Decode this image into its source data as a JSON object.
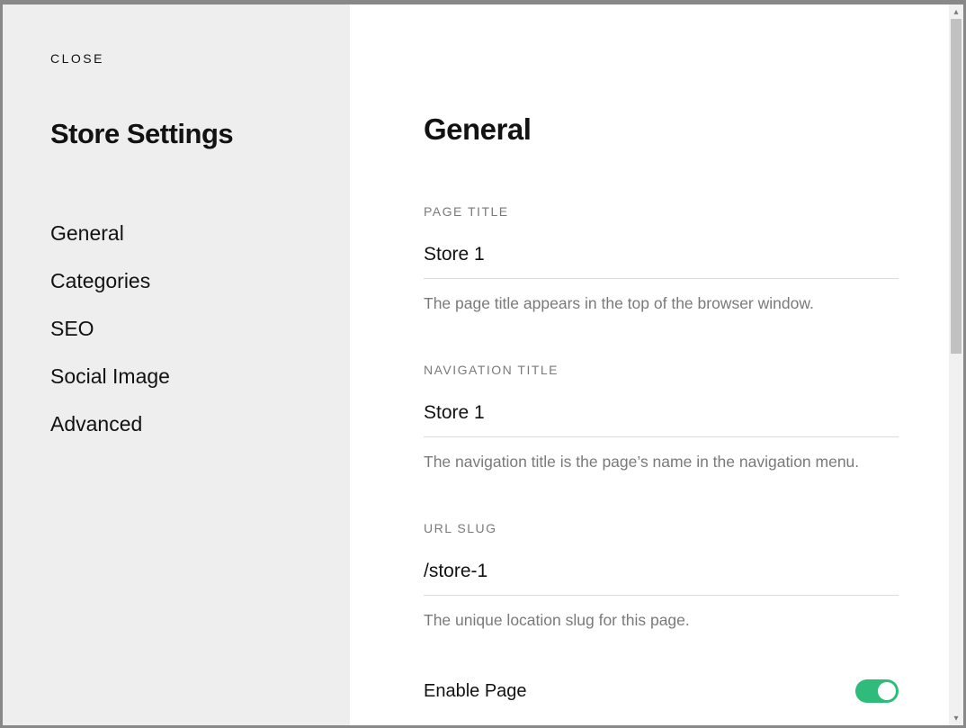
{
  "sidebar": {
    "close_label": "CLOSE",
    "title": "Store Settings",
    "items": [
      {
        "label": "General"
      },
      {
        "label": "Categories"
      },
      {
        "label": "SEO"
      },
      {
        "label": "Social Image"
      },
      {
        "label": "Advanced"
      }
    ]
  },
  "main": {
    "title": "General",
    "fields": {
      "page_title": {
        "label": "PAGE TITLE",
        "value": "Store 1",
        "help": "The page title appears in the top of the browser window."
      },
      "nav_title": {
        "label": "NAVIGATION TITLE",
        "value": "Store 1",
        "help": "The navigation title is the page’s name in the navigation menu."
      },
      "url_slug": {
        "label": "URL SLUG",
        "value": "/store-1",
        "help": "The unique location slug for this page."
      },
      "enable_page": {
        "label": "Enable Page",
        "checked": true
      }
    }
  }
}
